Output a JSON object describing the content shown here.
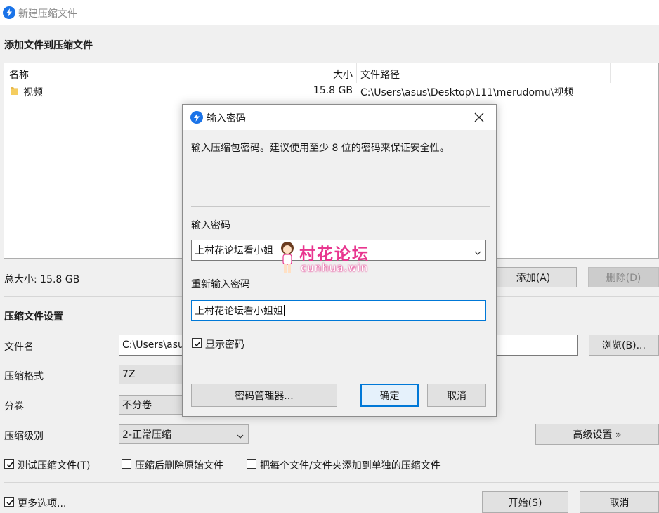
{
  "window": {
    "title": "新建压缩文件",
    "icon": "lightning-app-icon"
  },
  "add_section": {
    "title": "添加文件到压缩文件"
  },
  "file_list": {
    "columns": [
      "名称",
      "大小",
      "文件路径"
    ],
    "rows": [
      {
        "name": "视频",
        "size": "15.8 GB",
        "path": "C:\\Users\\asus\\Desktop\\111\\merudomu\\视频",
        "icon": "folder-icon"
      }
    ]
  },
  "total_size": "总大小: 15.8 GB",
  "add_button": "添加(A)",
  "delete_button": "删除(D)",
  "settings": {
    "title": "压缩文件设置",
    "filename_label": "文件名",
    "filename_value": "C:\\Users\\asus",
    "browse_button": "浏览(B)...",
    "format_label": "压缩格式",
    "format_value": "7Z",
    "split_label": "分卷",
    "split_value": "不分卷",
    "level_label": "压缩级别",
    "level_value": "2-正常压缩",
    "advanced_button": "高级设置 »",
    "test_checkbox": "测试压缩文件(T)",
    "test_checked": true,
    "delete_after_checkbox": "压缩后删除原始文件",
    "delete_after_checked": false,
    "separate_checkbox": "把每个文件/文件夹添加到单独的压缩文件",
    "separate_checked": false,
    "more_options_checkbox": "更多选项...",
    "more_options_checked": true
  },
  "start_button": "开始(S)",
  "cancel_button": "取消",
  "dialog": {
    "title": "输入密码",
    "description": "输入压缩包密码。建议使用至少 8 位的密码来保证安全性。",
    "password_label": "输入密码",
    "password_value": "上村花论坛看小姐",
    "reenter_label": "重新输入密码",
    "reenter_value": "上村花论坛看小姐姐",
    "show_password_label": "显示密码",
    "show_password_checked": true,
    "manager_button": "密码管理器...",
    "ok_button": "确定",
    "cancel_button": "取消"
  },
  "watermark": {
    "title": "村花论坛",
    "url": "cunhua.win"
  },
  "colors": {
    "accent": "#0078d7",
    "brand_icon": "#1a73e8",
    "watermark": "#e8368f"
  }
}
